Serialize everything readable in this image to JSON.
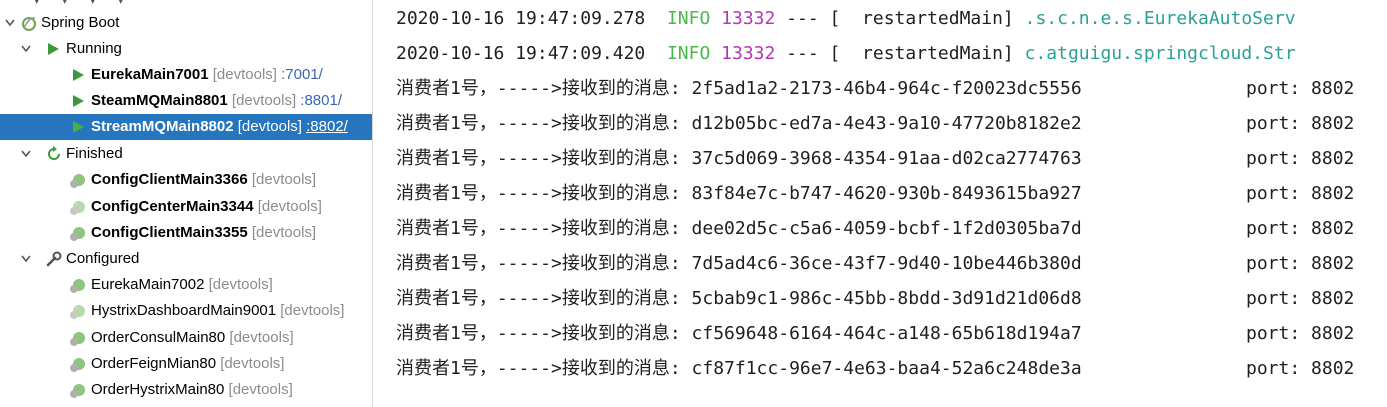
{
  "tree": {
    "items": [
      {
        "name": "Spring Boot",
        "suffix": ""
      },
      {
        "name": "Running",
        "suffix": ""
      },
      {
        "name": "EurekaMain7001",
        "devtools": "[devtools]",
        "port": ":7001/"
      },
      {
        "name": "SteamMQMain8801",
        "devtools": "[devtools]",
        "port": ":8801/"
      },
      {
        "name": "StreamMQMain8802",
        "devtools": "[devtools]",
        "port": ":8802/"
      },
      {
        "name": "Finished",
        "suffix": ""
      },
      {
        "name": "ConfigClientMain3366",
        "devtools": "[devtools]"
      },
      {
        "name": "ConfigCenterMain3344",
        "devtools": "[devtools]"
      },
      {
        "name": "ConfigClientMain3355",
        "devtools": "[devtools]"
      },
      {
        "name": "Configured",
        "suffix": ""
      },
      {
        "name": "EurekaMain7002",
        "devtools": "[devtools]"
      },
      {
        "name": "HystrixDashboardMain9001",
        "devtools": "[devtools]"
      },
      {
        "name": "OrderConsulMain80",
        "devtools": "[devtools]"
      },
      {
        "name": "OrderFeignMian80",
        "devtools": "[devtools]"
      },
      {
        "name": "OrderHystrixMain80",
        "devtools": "[devtools]"
      }
    ]
  },
  "console": {
    "log_lines": [
      {
        "timestamp": "2020-10-16 19:47:09.278",
        "level": "INFO",
        "pid": "13332",
        "sep": "---",
        "thread": "[  restartedMain]",
        "logger": ".s.c.n.e.s.EurekaAutoServ"
      },
      {
        "timestamp": "2020-10-16 19:47:09.420",
        "level": "INFO",
        "pid": "13332",
        "sep": "---",
        "thread": "[  restartedMain]",
        "logger": "c.atguigu.springcloud.Str"
      }
    ],
    "message_lines": [
      {
        "prefix": "消费者1号，----->接收到的消息: ",
        "msg": "2f5ad1a2-2173-46b4-964c-f20023dc5556",
        "port": "port: 8802"
      },
      {
        "prefix": "消费者1号，----->接收到的消息: ",
        "msg": "d12b05bc-ed7a-4e43-9a10-47720b8182e2",
        "port": "port: 8802"
      },
      {
        "prefix": "消费者1号，----->接收到的消息: ",
        "msg": "37c5d069-3968-4354-91aa-d02ca2774763",
        "port": "port: 8802"
      },
      {
        "prefix": "消费者1号，----->接收到的消息: ",
        "msg": "83f84e7c-b747-4620-930b-8493615ba927",
        "port": "port: 8802"
      },
      {
        "prefix": "消费者1号，----->接收到的消息: ",
        "msg": "dee02d5c-c5a6-4059-bcbf-1f2d0305ba7d",
        "port": "port: 8802"
      },
      {
        "prefix": "消费者1号，----->接收到的消息: ",
        "msg": "7d5ad4c6-36ce-43f7-9d40-10be446b380d",
        "port": "port: 8802"
      },
      {
        "prefix": "消费者1号，----->接收到的消息: ",
        "msg": "5cbab9c1-986c-45bb-8bdd-3d91d21d06d8",
        "port": "port: 8802"
      },
      {
        "prefix": "消费者1号，----->接收到的消息: ",
        "msg": "cf569648-6164-464c-a148-65b618d194a7",
        "port": "port: 8802"
      },
      {
        "prefix": "消费者1号，----->接收到的消息: ",
        "msg": "cf87f1cc-96e7-4e63-baa4-52a6c248de3a",
        "port": "port: 8802"
      }
    ]
  },
  "colors": {
    "selection": "#2675bf",
    "info": "#4cb84c",
    "pid": "#b437b4",
    "logger": "#2aa198",
    "run_arrow": "#3c9a3c",
    "muted": "#8c8c8c"
  },
  "icons": {
    "spring_boot": "spring-boot-icon",
    "running": "run-icon",
    "finished": "rerun-icon",
    "configured": "wrench-icon",
    "app": "spring-leaf-icon"
  }
}
